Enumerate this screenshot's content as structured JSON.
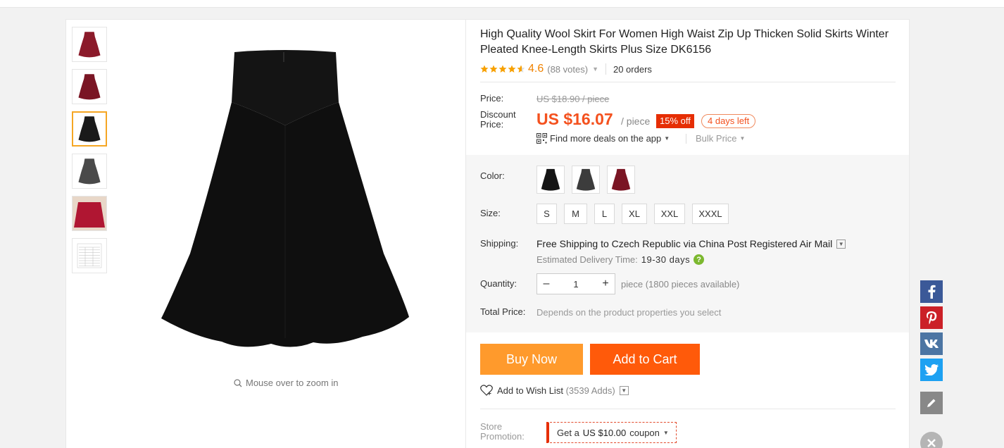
{
  "product": {
    "title": "High Quality Wool Skirt For Women High Waist Zip Up Thicken Solid Skirts Winter Pleated Knee-Length Skirts Plus Size DK6156",
    "rating_score": "4.6",
    "rating_stars": 4.6,
    "votes": "(88 votes)",
    "orders": "20 orders",
    "zoom_hint": "Mouse over to zoom in"
  },
  "colors": {
    "accent_orange": "#ff9a2c",
    "cart_red": "#ff5a0a",
    "price_red": "#f4511e",
    "thumb_active": "#f5a623"
  },
  "thumbnails": [
    {
      "color_name": "burgundy",
      "fill": "#8b1a2a"
    },
    {
      "color_name": "burgundy",
      "fill": "#7a1524"
    },
    {
      "color_name": "black",
      "fill": "#1a1a1a",
      "active": true
    },
    {
      "color_name": "gray",
      "fill": "#4a4a4a"
    },
    {
      "color_name": "red-photo",
      "fill": "#b01632"
    },
    {
      "color_name": "size-chart",
      "fill": "#eeeeee"
    }
  ],
  "pricing": {
    "price_label": "Price:",
    "old_price": "US $18.90 / piece",
    "discount_label": "Discount Price:",
    "discount_price": "US $16.07",
    "per_piece": "/ piece",
    "off_badge": "15% off",
    "days_left": "4 days left",
    "app_deals": "Find more deals on the app",
    "bulk_price": "Bulk Price"
  },
  "options": {
    "color_label": "Color:",
    "color_swatches": [
      {
        "name": "black",
        "fill": "#151515"
      },
      {
        "name": "gray",
        "fill": "#3c3c3c"
      },
      {
        "name": "burgundy",
        "fill": "#7a1524"
      }
    ],
    "size_label": "Size:",
    "sizes": [
      "S",
      "M",
      "L",
      "XL",
      "XXL",
      "XXXL"
    ],
    "shipping_label": "Shipping:",
    "shipping_bold": "Free Shipping",
    "shipping_to": "to",
    "shipping_country": "Czech Republic",
    "shipping_via": "via",
    "shipping_method": "China Post Registered Air Mail",
    "delivery_label": "Estimated Delivery Time:",
    "delivery_days": "19-30 days",
    "quantity_label": "Quantity:",
    "quantity_value": "1",
    "availability": "piece (1800 pieces available)",
    "total_label": "Total Price:",
    "total_value": "Depends on the product properties you select"
  },
  "actions": {
    "buy_now": "Buy Now",
    "add_to_cart": "Add to Cart",
    "wishlist": "Add to Wish List",
    "wishlist_adds": "(3539 Adds)"
  },
  "promotion": {
    "label": "Store Promotion:",
    "coupon_prefix": "Get a",
    "coupon_amount": "US $10.00",
    "coupon_suffix": "coupon"
  },
  "social": [
    "facebook-icon",
    "pinterest-icon",
    "vk-icon",
    "twitter-icon",
    "edit-icon",
    "close-icon"
  ]
}
